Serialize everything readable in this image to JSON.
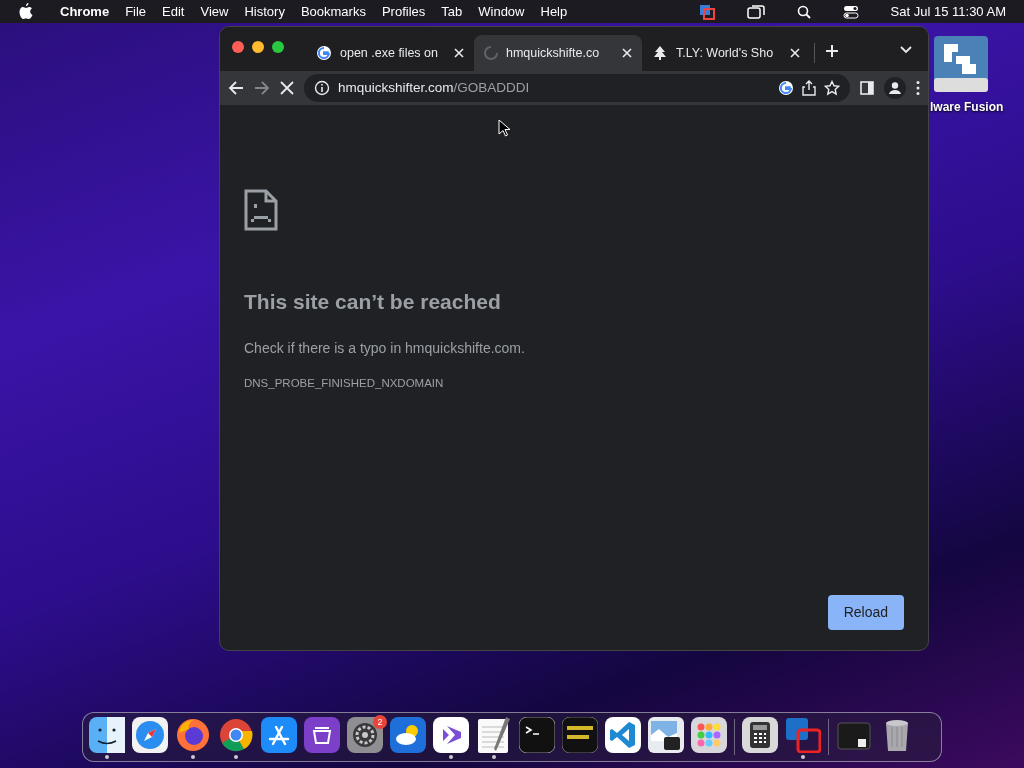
{
  "menu_bar": {
    "app": "Chrome",
    "items": [
      "File",
      "Edit",
      "View",
      "History",
      "Bookmarks",
      "Profiles",
      "Tab",
      "Window",
      "Help"
    ],
    "clock": "Sat Jul 15  11:30 AM"
  },
  "desktop_icon": {
    "label": "lware Fusion"
  },
  "browser": {
    "tabs": [
      {
        "title": "open .exe files on",
        "kind": "google",
        "selected": false
      },
      {
        "title": "hmquickshifte.co",
        "kind": "loading",
        "selected": true
      },
      {
        "title": "T.LY: World's Sho",
        "kind": "tree",
        "selected": false
      }
    ],
    "address": {
      "host": "hmquickshifter.com",
      "path": "/GOBADDDI"
    },
    "loading": true,
    "error": {
      "title": "This site can’t be reached",
      "message": "Check if there is a typo in hmquickshifte.com.",
      "code": "DNS_PROBE_FINISHED_NXDOMAIN",
      "button": "Reload"
    }
  },
  "dock": {
    "items": [
      {
        "kind": "finder",
        "running": true
      },
      {
        "kind": "safari",
        "running": false
      },
      {
        "kind": "firefox",
        "running": true
      },
      {
        "kind": "chrome",
        "running": true
      },
      {
        "kind": "appstore",
        "running": false
      },
      {
        "kind": "podcasts",
        "running": false
      },
      {
        "kind": "settings",
        "running": false,
        "badge": "2"
      },
      {
        "kind": "weather",
        "running": false
      },
      {
        "kind": "xcode",
        "running": true
      },
      {
        "kind": "textedit",
        "running": true
      },
      {
        "kind": "terminal",
        "running": false
      },
      {
        "kind": "console",
        "running": false
      },
      {
        "kind": "vscode",
        "running": false
      },
      {
        "kind": "preview",
        "running": false
      },
      {
        "kind": "launchpad",
        "running": false
      },
      {
        "kind": "separator"
      },
      {
        "kind": "calculator",
        "running": false
      },
      {
        "kind": "vmware",
        "running": true
      },
      {
        "kind": "separator"
      },
      {
        "kind": "folder",
        "running": false
      },
      {
        "kind": "trash",
        "running": false
      }
    ]
  }
}
